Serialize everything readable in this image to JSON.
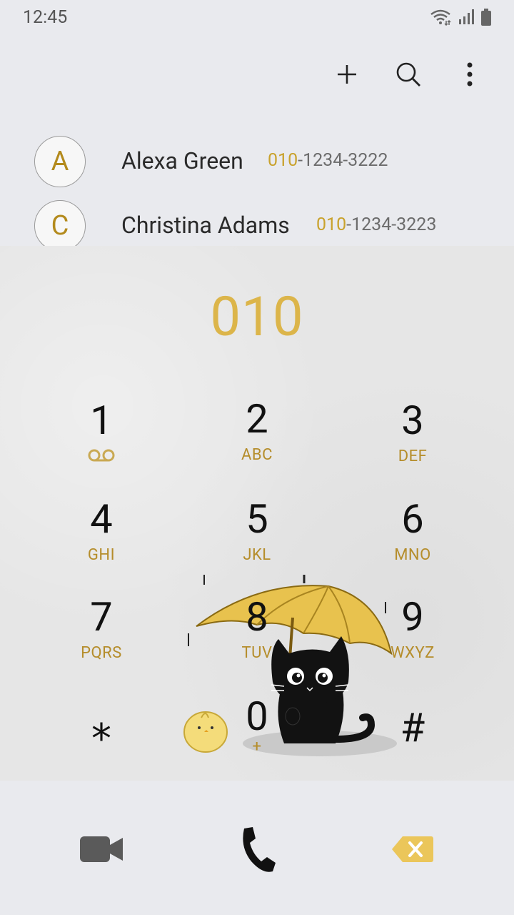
{
  "status": {
    "time": "12:45"
  },
  "toolbar": {
    "add_icon": "plus-icon",
    "search_icon": "search-icon",
    "more_icon": "more-vert-icon"
  },
  "contacts": [
    {
      "initial": "A",
      "name": "Alexa Green",
      "number_match": "010",
      "number_rest": "-1234-3222"
    },
    {
      "initial": "C",
      "name": "Christina Adams",
      "number_match": "010",
      "number_rest": "-1234-3223"
    }
  ],
  "dialpad": {
    "entered_number": "010",
    "keys": [
      {
        "digit": "1",
        "letters": ""
      },
      {
        "digit": "2",
        "letters": "ABC"
      },
      {
        "digit": "3",
        "letters": "DEF"
      },
      {
        "digit": "4",
        "letters": "GHI"
      },
      {
        "digit": "5",
        "letters": "JKL"
      },
      {
        "digit": "6",
        "letters": "MNO"
      },
      {
        "digit": "7",
        "letters": "PQRS"
      },
      {
        "digit": "8",
        "letters": "TUV"
      },
      {
        "digit": "9",
        "letters": "WXYZ"
      },
      {
        "digit": "⁎",
        "letters": ""
      },
      {
        "digit": "0",
        "letters": "+"
      },
      {
        "digit": "#",
        "letters": ""
      }
    ]
  },
  "bottom": {
    "video_icon": "video-call-icon",
    "call_icon": "phone-icon",
    "backspace_icon": "backspace-icon"
  },
  "colors": {
    "accent": "#dcb54a",
    "letters": "#b58d2b",
    "background": "#e9eaee"
  }
}
